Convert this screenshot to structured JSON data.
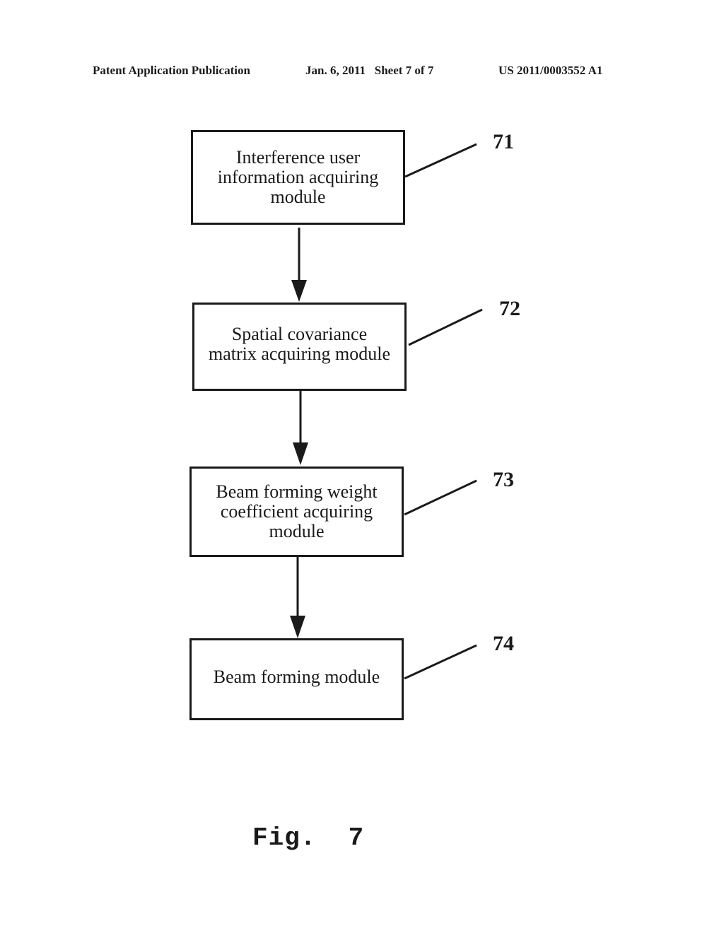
{
  "header": {
    "publication": "Patent Application Publication",
    "date_sheet": "Jan. 6, 2011   Sheet 7 of 7",
    "number": "US 2011/0003552 A1"
  },
  "modules": [
    {
      "ref": "71",
      "label_lines": [
        "Interference user",
        "information acquiring",
        "module"
      ]
    },
    {
      "ref": "72",
      "label_lines": [
        "Spatial covariance",
        "matrix acquiring module"
      ]
    },
    {
      "ref": "73",
      "label_lines": [
        "Beam forming weight",
        "coefficient acquiring",
        "module"
      ]
    },
    {
      "ref": "74",
      "label_lines": [
        "Beam forming module"
      ]
    }
  ],
  "figure_label": "Fig.  7"
}
